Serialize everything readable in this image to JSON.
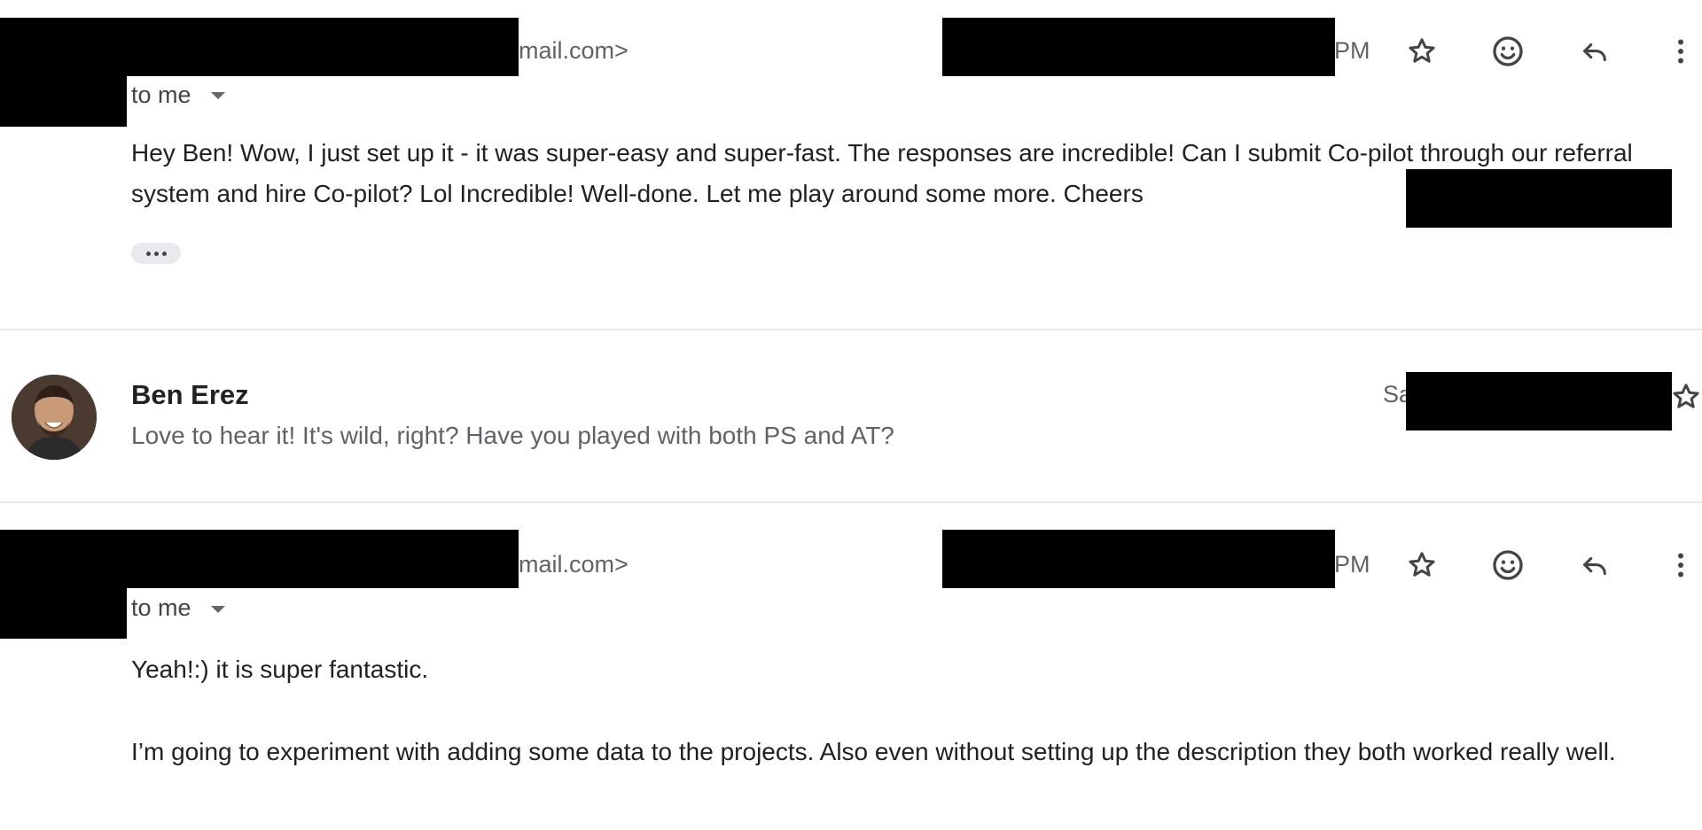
{
  "message1": {
    "sender_suffix": "mail.com>",
    "time_suffix": "PM",
    "recipient": "to me",
    "body": "Hey Ben! Wow, I just set up it - it was super-easy and super-fast. The responses are incredible! Can I submit Co-pilot through our referral system and hire Co-pilot? Lol Incredible! Well-done. Let me play around some more. Cheers"
  },
  "message2": {
    "sender_name": "Ben Erez",
    "snippet": "Love to hear it! It's wild, right? Have you played with both PS and AT?",
    "date_prefix": "Sa"
  },
  "message3": {
    "sender_suffix": "mail.com>",
    "time_suffix": "PM",
    "recipient": "to me",
    "body_p1": "Yeah!:) it is super fantastic.",
    "body_p2": "I’m going to experiment with adding some data to the projects. Also even without setting up the description they both worked really well."
  },
  "icons": {
    "star": "star-icon",
    "emoji": "emoji-icon",
    "reply": "reply-icon",
    "more": "more-vert-icon",
    "dropdown": "arrow-drop-down-icon"
  }
}
